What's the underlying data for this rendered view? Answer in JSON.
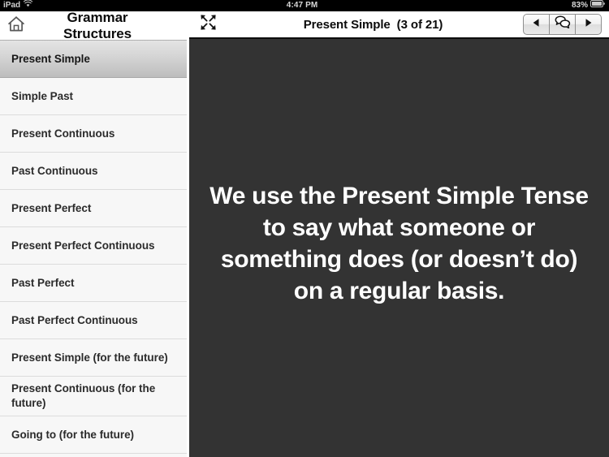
{
  "status_bar": {
    "carrier": "iPad",
    "wifi_icon": "wifi-icon",
    "time": "4:47 PM",
    "battery_percent": "83%",
    "battery_icon": "battery-icon"
  },
  "sidebar": {
    "home_icon": "home-icon",
    "title": "Grammar Structures",
    "items": [
      {
        "label": "Present Simple",
        "selected": true
      },
      {
        "label": "Simple Past",
        "selected": false
      },
      {
        "label": "Present Continuous",
        "selected": false
      },
      {
        "label": "Past Continuous",
        "selected": false
      },
      {
        "label": "Present Perfect",
        "selected": false
      },
      {
        "label": "Present Perfect Continuous",
        "selected": false
      },
      {
        "label": "Past Perfect",
        "selected": false
      },
      {
        "label": "Past Perfect Continuous",
        "selected": false
      },
      {
        "label": "Present Simple (for the future)",
        "selected": false
      },
      {
        "label": "Present Continuous (for the future)",
        "selected": false
      },
      {
        "label": "Going to (for the future)",
        "selected": false
      }
    ]
  },
  "detail": {
    "expand_icon": "expand-icon",
    "title": "Present Simple",
    "counter": "(3 of 21)",
    "nav": {
      "previous_icon": "triangle-left-icon",
      "speech_icon": "speech-bubbles-icon",
      "next_icon": "triangle-right-icon"
    },
    "body_text": "We use the Present Simple Tense to say what someone or something does (or doesn’t do) on a regular basis.",
    "background_color": "#333333",
    "text_color": "#ffffff"
  }
}
